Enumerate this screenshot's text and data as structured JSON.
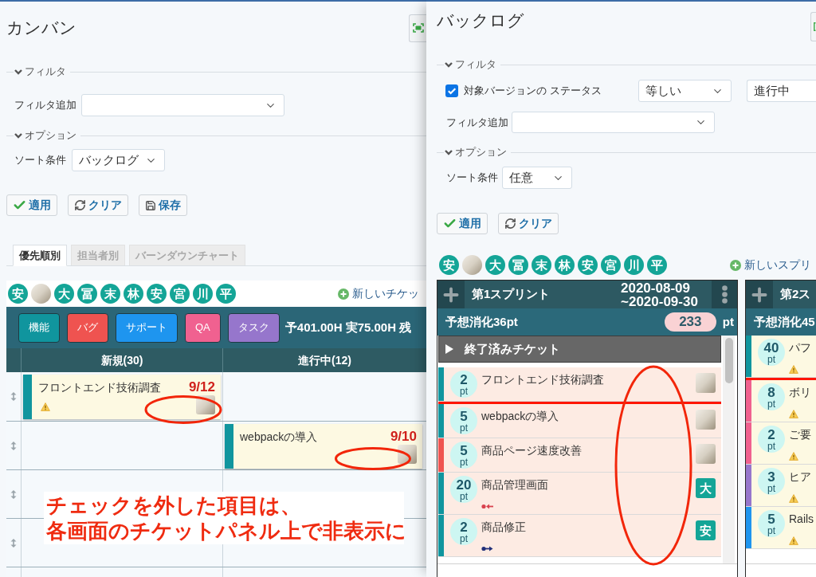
{
  "kanban": {
    "title": "カンバン",
    "filter_legend": "フィルタ",
    "add_filter_label": "フィルタ追加",
    "options_legend": "オプション",
    "sort_label": "ソート条件",
    "sort_value": "バックログ",
    "buttons": [
      {
        "kind": "apply",
        "label": "適用"
      },
      {
        "kind": "clear",
        "label": "クリア"
      },
      {
        "kind": "save",
        "label": "保存"
      }
    ],
    "tabs": [
      {
        "label": "優先順別",
        "selected": true
      },
      {
        "label": "担当者別",
        "selected": false
      },
      {
        "label": "バーンダウンチャート",
        "selected": false
      }
    ],
    "members": [
      {
        "kind": "initial",
        "label": "安"
      },
      {
        "kind": "photo"
      },
      {
        "kind": "initial",
        "label": "大"
      },
      {
        "kind": "initial",
        "label": "冨"
      },
      {
        "kind": "initial",
        "label": "末"
      },
      {
        "kind": "initial",
        "label": "林"
      },
      {
        "kind": "initial",
        "label": "安"
      },
      {
        "kind": "initial",
        "label": "宮"
      },
      {
        "kind": "initial",
        "label": "川"
      },
      {
        "kind": "initial",
        "label": "平"
      }
    ],
    "new_ticket_link": "新しいチケッ",
    "trackers": [
      {
        "label": "機能",
        "color": "#10959e"
      },
      {
        "label": "バグ",
        "color": "#ef5350"
      },
      {
        "label": "サポート",
        "color": "#1e95ef"
      },
      {
        "label": "QA",
        "color": "#f06190"
      },
      {
        "label": "タスク",
        "color": "#9676cc"
      }
    ],
    "hours_summary": "予401.00H 実75.00H 残",
    "columns": [
      "新規(30)",
      "進行中(12)"
    ],
    "rows": [
      {
        "kind": "lane",
        "new_cards": [
          {
            "title": "フロントエンド技術調査",
            "due": "9/12",
            "color": "#10959e",
            "warning": true,
            "assignee": {
              "kind": "photo"
            }
          }
        ]
      },
      {
        "kind": "lane",
        "in_progress_cards": [
          {
            "title": "webpackの導入",
            "due": "9/10",
            "color": "#10959e",
            "warning": false,
            "assignee": {
              "kind": "photo"
            }
          }
        ]
      },
      {
        "kind": "lane"
      },
      {
        "kind": "lane"
      }
    ]
  },
  "backlog": {
    "title": "バックログ",
    "filter_legend": "フィルタ",
    "filters": [
      {
        "checked": true,
        "label": "対象バージョンの ステータス",
        "operator": "等しい",
        "value": "進行中"
      }
    ],
    "add_filter_label": "フィルタ追加",
    "options_legend": "オプション",
    "sort_label": "ソート条件",
    "sort_value": "任意",
    "buttons": [
      {
        "kind": "apply",
        "label": "適用"
      },
      {
        "kind": "clear",
        "label": "クリア"
      }
    ],
    "members": [
      {
        "kind": "initial",
        "label": "安"
      },
      {
        "kind": "photo"
      },
      {
        "kind": "initial",
        "label": "大"
      },
      {
        "kind": "initial",
        "label": "冨"
      },
      {
        "kind": "initial",
        "label": "末"
      },
      {
        "kind": "initial",
        "label": "林"
      },
      {
        "kind": "initial",
        "label": "安"
      },
      {
        "kind": "initial",
        "label": "宮"
      },
      {
        "kind": "initial",
        "label": "川"
      },
      {
        "kind": "initial",
        "label": "平"
      }
    ],
    "new_sprint_link": "新しいスプリ",
    "sprints": [
      {
        "title": "第1スプリント",
        "dates": [
          "2020-08-09",
          "~2020-09-30"
        ],
        "estimate": "予想消化36pt",
        "capacity": "233",
        "capacity_unit": "pt",
        "highlighted": true,
        "closed_tickets": "終了済みチケット",
        "tickets": [
          {
            "kind": "ticket",
            "points": "2",
            "unit": "pt",
            "title": "フロントエンド技術調査",
            "color": "#10959e",
            "assignee": {
              "kind": "photo"
            }
          },
          {
            "kind": "capacity_line"
          },
          {
            "kind": "ticket",
            "points": "5",
            "unit": "pt",
            "title": "webpackの導入",
            "color": "#10959e",
            "assignee": {
              "kind": "photo"
            }
          },
          {
            "kind": "ticket",
            "points": "5",
            "unit": "pt",
            "title": "商品ページ速度改善",
            "color": "#ef5350",
            "assignee": {
              "kind": "photo"
            }
          },
          {
            "kind": "ticket",
            "points": "20",
            "unit": "pt",
            "title": "商品管理画面",
            "color": "#10959e",
            "relation": {
              "kind": "back"
            },
            "assignee": {
              "kind": "initial",
              "label": "大"
            }
          },
          {
            "kind": "ticket",
            "points": "2",
            "unit": "pt",
            "title": "商品修正",
            "color": "#10959e",
            "relation": {
              "kind": "forward"
            },
            "assignee": {
              "kind": "initial",
              "label": "安"
            }
          }
        ]
      },
      {
        "title": "第2ス",
        "estimate": "予想消化45",
        "highlighted": false,
        "tickets": [
          {
            "kind": "ticket",
            "points": "40",
            "unit": "pt",
            "title": "パフ",
            "color": "#10959e",
            "warning": true
          },
          {
            "kind": "capacity_line"
          },
          {
            "kind": "ticket",
            "points": "8",
            "unit": "pt",
            "title": "ボリ",
            "color": "#f06190",
            "warning": true
          },
          {
            "kind": "ticket",
            "points": "2",
            "unit": "pt",
            "title": "ご要",
            "color": "#f06190",
            "warning": true
          },
          {
            "kind": "ticket",
            "points": "3",
            "unit": "pt",
            "title": "ヒア",
            "color": "#9676cc",
            "warning": true
          },
          {
            "kind": "ticket",
            "points": "5",
            "unit": "pt",
            "title": "Rails",
            "color": "#1e95ef",
            "warning": true
          }
        ]
      }
    ]
  },
  "annotation": {
    "callout": [
      "チェックを外した項目は、",
      "各画面のチケットパネル上で非表示に"
    ]
  }
}
